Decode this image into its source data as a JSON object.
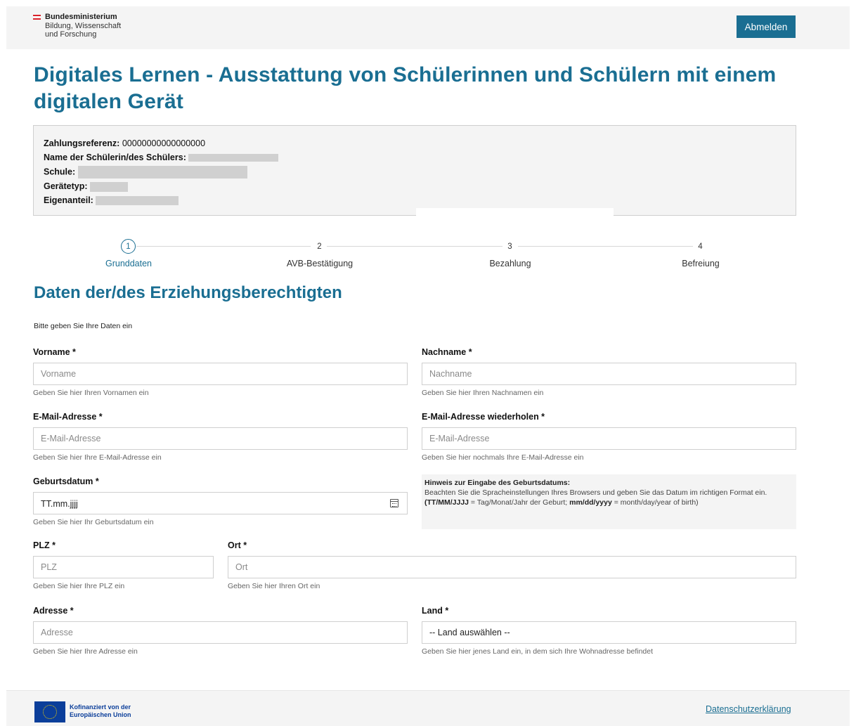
{
  "header": {
    "ministry_line1": "Bundesministerium",
    "ministry_line2": "Bildung, Wissenschaft",
    "ministry_line3": "und Forschung",
    "logout_label": "Abmelden"
  },
  "page_title": "Digitales Lernen - Ausstattung von Schülerinnen und Schülern mit einem digitalen Gerät",
  "summary": {
    "payment_ref_label": "Zahlungsreferenz:",
    "payment_ref_value": "00000000000000000",
    "student_label": "Name der Schülerin/des Schülers:",
    "school_label": "Schule:",
    "device_label": "Gerätetyp:",
    "share_label": "Eigenanteil:"
  },
  "stepper": {
    "steps": [
      {
        "number": "1",
        "label": "Grunddaten",
        "active": true
      },
      {
        "number": "2",
        "label": "AVB-Bestätigung",
        "active": false
      },
      {
        "number": "3",
        "label": "Bezahlung",
        "active": false
      },
      {
        "number": "4",
        "label": "Befreiung",
        "active": false
      }
    ]
  },
  "section_title": "Daten der/des Erziehungsberechtigten",
  "intro": "Bitte geben Sie Ihre Daten ein",
  "form": {
    "firstname": {
      "label": "Vorname *",
      "placeholder": "Vorname",
      "help": "Geben Sie hier Ihren Vornamen ein"
    },
    "lastname": {
      "label": "Nachname *",
      "placeholder": "Nachname",
      "help": "Geben Sie hier Ihren Nachnamen ein"
    },
    "email": {
      "label": "E-Mail-Adresse *",
      "placeholder": "E-Mail-Adresse",
      "help": "Geben Sie hier Ihre E-Mail-Adresse ein"
    },
    "email_repeat": {
      "label": "E-Mail-Adresse wiederholen *",
      "placeholder": "E-Mail-Adresse",
      "help": "Geben Sie hier nochmals Ihre E-Mail-Adresse ein"
    },
    "birthdate": {
      "label": "Geburtsdatum *",
      "value": "TT.mm.jjjj",
      "help": "Geben Sie hier Ihr Geburtsdatum ein"
    },
    "hint": {
      "title": "Hinweis zur Eingabe des Geburtsdatums:",
      "body": "Beachten Sie die Spracheinstellungen Ihres Browsers und geben Sie das Datum im richtigen Format ein.",
      "fmt1": "(TT/MM/JJJJ",
      "fmt1_desc": " = Tag/Monat/Jahr der Geburt; ",
      "fmt2": "mm/dd/yyyy",
      "fmt2_desc": " = month/day/year of birth)"
    },
    "zip": {
      "label": "PLZ *",
      "placeholder": "PLZ",
      "help": "Geben Sie hier Ihre PLZ ein"
    },
    "city": {
      "label": "Ort *",
      "placeholder": "Ort",
      "help": "Geben Sie hier Ihren Ort ein"
    },
    "address": {
      "label": "Adresse *",
      "placeholder": "Adresse",
      "help": "Geben Sie hier Ihre Adresse ein"
    },
    "country": {
      "label": "Land *",
      "selected": "-- Land auswählen --",
      "help": "Geben Sie hier jenes Land ein, in dem sich Ihre Wohnadresse befindet"
    }
  },
  "footer": {
    "eu_line1": "Kofinanziert von der",
    "eu_line2": "Europäischen Union",
    "privacy_link": "Datenschutzerklärung"
  }
}
